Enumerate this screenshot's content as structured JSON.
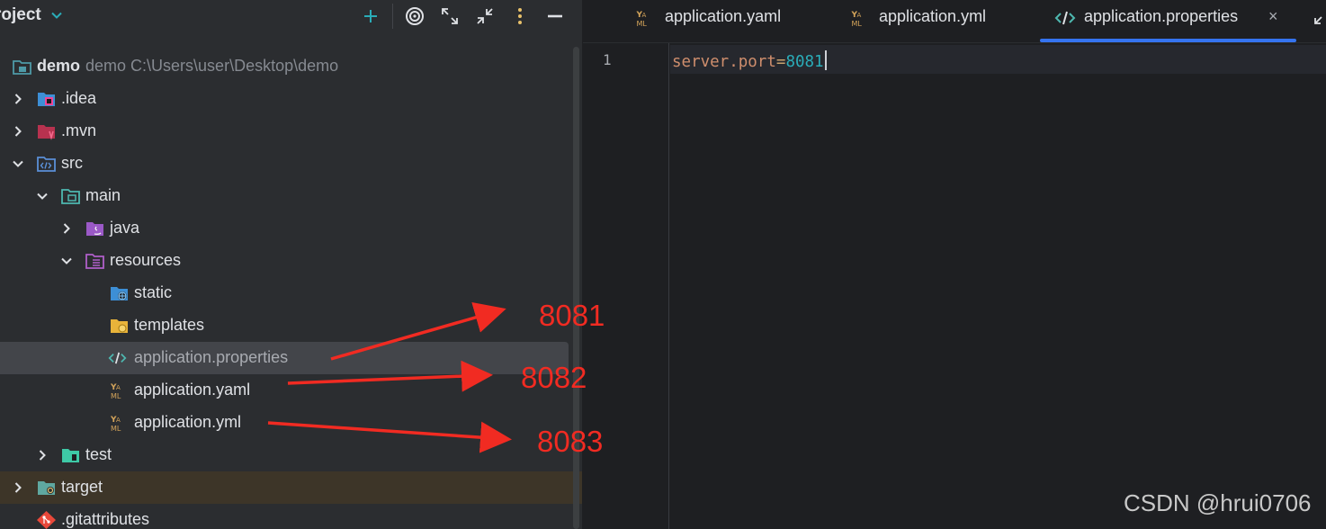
{
  "project_panel": {
    "title": "roject",
    "tree": [
      {
        "name": "demo",
        "meta": "demo  C:\\Users\\user\\Desktop\\demo"
      },
      {
        "name": ".idea"
      },
      {
        "name": ".mvn"
      },
      {
        "name": "src"
      },
      {
        "name": "main"
      },
      {
        "name": "java"
      },
      {
        "name": "resources"
      },
      {
        "name": "static"
      },
      {
        "name": "templates"
      },
      {
        "name": "application.properties",
        "selected": true
      },
      {
        "name": "application.yaml"
      },
      {
        "name": "application.yml"
      },
      {
        "name": "test"
      },
      {
        "name": "target"
      },
      {
        "name": ".gitattributes"
      }
    ]
  },
  "editor": {
    "tabs": [
      {
        "label": "application.yaml",
        "icon": "yaml-icon"
      },
      {
        "label": "application.yml",
        "icon": "yaml-icon"
      },
      {
        "label": "application.properties",
        "icon": "properties-icon",
        "active": true,
        "close": "×"
      }
    ],
    "lines": [
      {
        "number": "1",
        "key": "server.port",
        "eq": "=",
        "value": "8081"
      }
    ]
  },
  "annotations": {
    "labels": [
      "8081",
      "8082",
      "8083"
    ],
    "color": "#f12b22",
    "watermark": "CSDN @hrui0706"
  },
  "colors": {
    "panel_bg": "#2b2d30",
    "editor_bg": "#1e1f22",
    "selection": "#43454a",
    "accent": "#3574f0"
  }
}
